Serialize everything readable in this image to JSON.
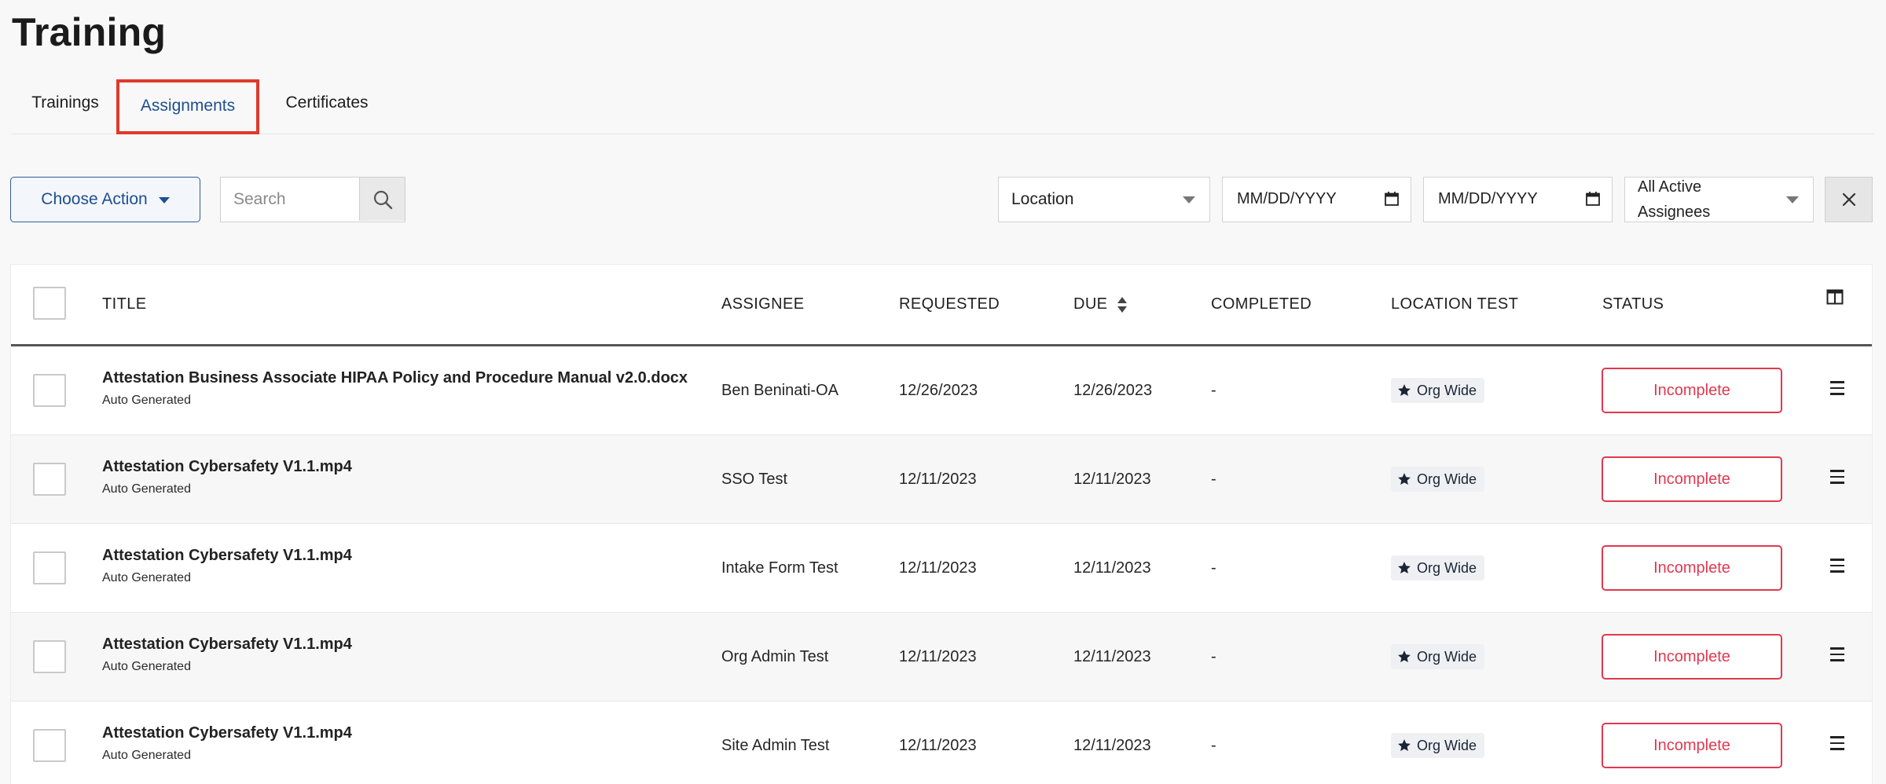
{
  "page": {
    "title": "Training"
  },
  "tabs": [
    {
      "label": "Trainings"
    },
    {
      "label": "Assignments"
    },
    {
      "label": "Certificates"
    }
  ],
  "toolbar": {
    "action_label": "Choose Action",
    "search_placeholder": "Search",
    "location_label": "Location",
    "date_from_placeholder": "MM/DD/YYYY",
    "date_to_placeholder": "MM/DD/YYYY",
    "assignees_label": "All Active Assignees"
  },
  "table": {
    "columns": {
      "title": "TITLE",
      "assignee": "ASSIGNEE",
      "requested": "REQUESTED",
      "due": "DUE",
      "completed": "COMPLETED",
      "location": "LOCATION TEST",
      "status": "STATUS"
    },
    "rows": [
      {
        "title": "Attestation Business Associate HIPAA Policy and Procedure Manual v2.0.docx",
        "subtitle": "Auto Generated",
        "assignee": "Ben Beninati-OA",
        "requested": "12/26/2023",
        "due": "12/26/2023",
        "completed": "-",
        "location": "Org Wide",
        "status": "Incomplete"
      },
      {
        "title": "Attestation Cybersafety V1.1.mp4",
        "subtitle": "Auto Generated",
        "assignee": "SSO Test",
        "requested": "12/11/2023",
        "due": "12/11/2023",
        "completed": "-",
        "location": "Org Wide",
        "status": "Incomplete"
      },
      {
        "title": "Attestation Cybersafety V1.1.mp4",
        "subtitle": "Auto Generated",
        "assignee": "Intake Form Test",
        "requested": "12/11/2023",
        "due": "12/11/2023",
        "completed": "-",
        "location": "Org Wide",
        "status": "Incomplete"
      },
      {
        "title": "Attestation Cybersafety V1.1.mp4",
        "subtitle": "Auto Generated",
        "assignee": "Org Admin Test",
        "requested": "12/11/2023",
        "due": "12/11/2023",
        "completed": "-",
        "location": "Org Wide",
        "status": "Incomplete"
      },
      {
        "title": "Attestation Cybersafety V1.1.mp4",
        "subtitle": "Auto Generated",
        "assignee": "Site Admin Test",
        "requested": "12/11/2023",
        "due": "12/11/2023",
        "completed": "-",
        "location": "Org Wide",
        "status": "Incomplete"
      }
    ]
  },
  "icons": {
    "search": "search-icon",
    "calendar": "calendar-icon",
    "close": "close-icon",
    "sort": "sort-icon",
    "columns": "columns-icon",
    "star": "star-icon",
    "menu": "menu-icon"
  },
  "colors": {
    "accent": "#1d4f91",
    "tab_highlight": "#de3a2c",
    "status_incomplete": "#e0394f"
  }
}
